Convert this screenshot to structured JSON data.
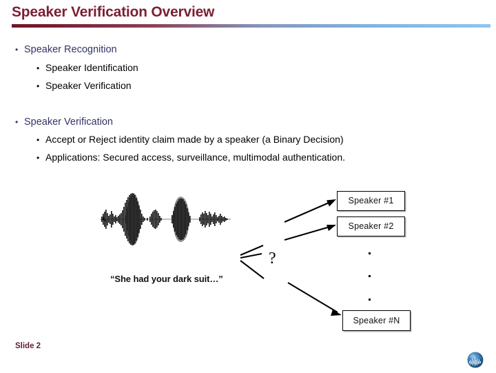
{
  "slide": {
    "title": "Speaker Verification Overview",
    "slide_number_label": "Slide 2",
    "title_color": "#7b1f34",
    "level1_color": "#333366",
    "level2_color": "#000000",
    "rule_gradient_from": "#6d1528",
    "rule_gradient_to": "#8fc6ee"
  },
  "bullet_blocks": [
    {
      "heading": "Speaker Recognition",
      "items": [
        "Speaker Identification",
        "Speaker Verification"
      ]
    },
    {
      "heading": "Speaker Verification",
      "items": [
        "Accept or Reject identity claim made by a speaker (a Binary Decision)",
        "Applications: Secured access, surveillance, multimodal authentication."
      ]
    }
  ],
  "bullet_marker": "•",
  "diagram": {
    "waveform_caption": "“She had your dark suit…”",
    "question_mark": "?",
    "speaker_boxes": [
      {
        "label": "Speaker #1"
      },
      {
        "label": "Speaker #2"
      },
      {
        "label": "Speaker #N"
      }
    ],
    "ellipsis_dots": 3
  },
  "logo": {
    "icon": "globe-waveform-logo",
    "color": "#2a6ea8"
  }
}
